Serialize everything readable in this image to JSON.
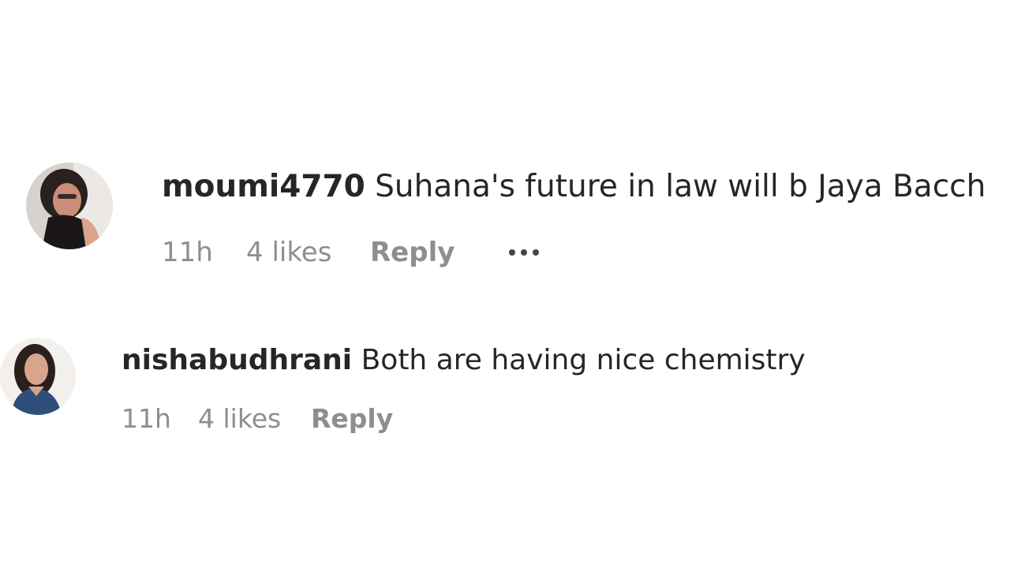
{
  "comments": [
    {
      "username": "moumi4770",
      "text": "Suhana's future in law will b Jaya Bacch",
      "time": "11h",
      "likes": "4 likes",
      "reply_label": "Reply",
      "more_icon": "more-options-icon"
    },
    {
      "username": "nishabudhrani",
      "text": "Both are having nice chemistry",
      "time": "11h",
      "likes": "4 likes",
      "reply_label": "Reply"
    }
  ]
}
